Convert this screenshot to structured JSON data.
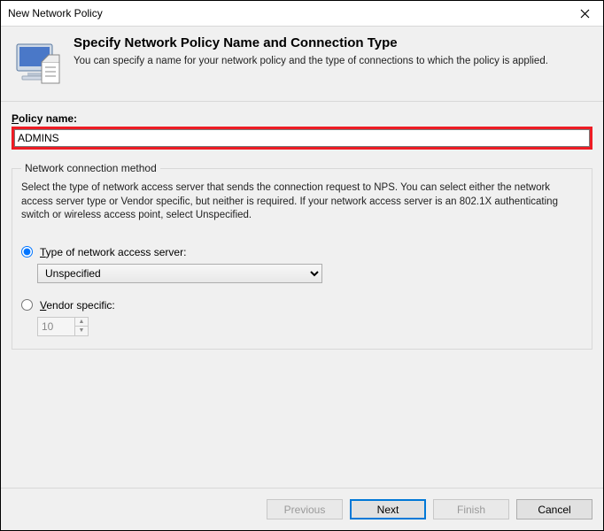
{
  "window": {
    "title": "New Network Policy"
  },
  "header": {
    "title": "Specify Network Policy Name and Connection Type",
    "subtitle": "You can specify a name for your network policy and the type of connections to which the policy is applied."
  },
  "policy_name": {
    "label_pre": "P",
    "label_rest": "olicy name:",
    "value": "ADMINS"
  },
  "ncm": {
    "legend": "Network connection method",
    "description": "Select the type of network access server that sends the connection request to NPS. You can select either the network access server type or Vendor specific, but neither is required. If your network access server is an 802.1X authenticating switch or wireless access point, select Unspecified.",
    "radio_type_pre": "T",
    "radio_type_rest": "ype of network access server:",
    "type_selected": "Unspecified",
    "type_options": [
      "Unspecified"
    ],
    "radio_vendor_pre": "V",
    "radio_vendor_rest": "endor specific:",
    "vendor_value": "10"
  },
  "buttons": {
    "previous": "Previous",
    "next": "Next",
    "finish": "Finish",
    "cancel": "Cancel"
  }
}
